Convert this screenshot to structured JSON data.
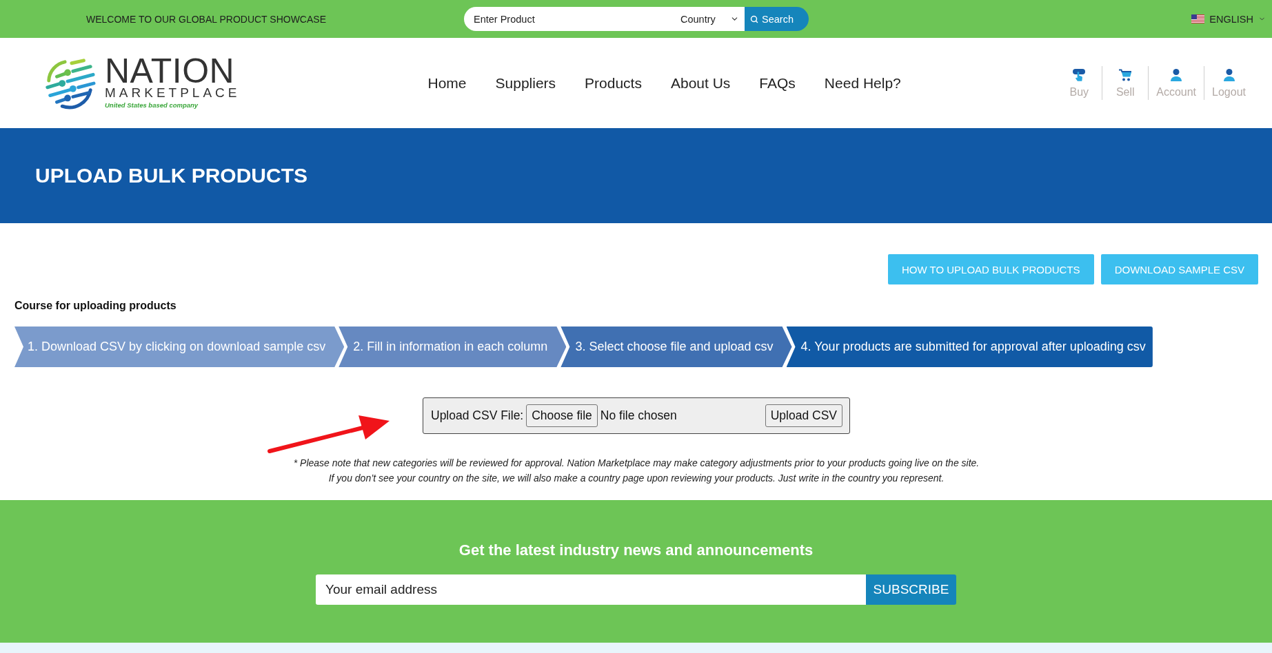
{
  "top_bar": {
    "welcome": "WELCOME TO OUR GLOBAL PRODUCT SHOWCASE",
    "search": {
      "placeholder": "Enter Product",
      "country": "Country",
      "button": "Search"
    },
    "language": "ENGLISH"
  },
  "header": {
    "logo": {
      "name": "NATION",
      "subtitle": "MARKETPLACE",
      "tagline": "United States based company"
    },
    "nav": [
      "Home",
      "Suppliers",
      "Products",
      "About Us",
      "FAQs",
      "Need Help?"
    ],
    "user_links": [
      {
        "kind": "buy",
        "label": "Buy"
      },
      {
        "kind": "sell",
        "label": "Sell"
      },
      {
        "kind": "account",
        "label": "Account"
      },
      {
        "kind": "logout",
        "label": "Logout"
      }
    ]
  },
  "banner": {
    "title": "UPLOAD BULK PRODUCTS"
  },
  "actions": [
    "HOW TO UPLOAD BULK PRODUCTS",
    "DOWNLOAD SAMPLE CSV"
  ],
  "course": {
    "title": "Course for uploading products",
    "steps": [
      {
        "label": "1. Download CSV by clicking on download sample csv",
        "color": "#7b9bcc"
      },
      {
        "label": "2. Fill in information in each column",
        "color": "#6689c1"
      },
      {
        "label": "3. Select choose file and upload csv",
        "color": "#4070b2"
      },
      {
        "label": "4. Your products are submitted for approval after uploading csv",
        "color": "#115aa6"
      }
    ]
  },
  "upload": {
    "label": "Upload CSV File:",
    "choose_button": "Choose file",
    "file_status": "No file chosen",
    "submit_button": "Upload CSV"
  },
  "notes": [
    "* Please note that new categories will be reviewed for approval. Nation Marketplace may make category adjustments prior to your products going live on the site.",
    "If you don’t see your country on the site, we will also make a country page upon reviewing your products. Just write in the country you represent."
  ],
  "newsletter": {
    "title": "Get the latest industry news and announcements",
    "placeholder": "Your email address",
    "button": "SUBSCRIBE"
  }
}
